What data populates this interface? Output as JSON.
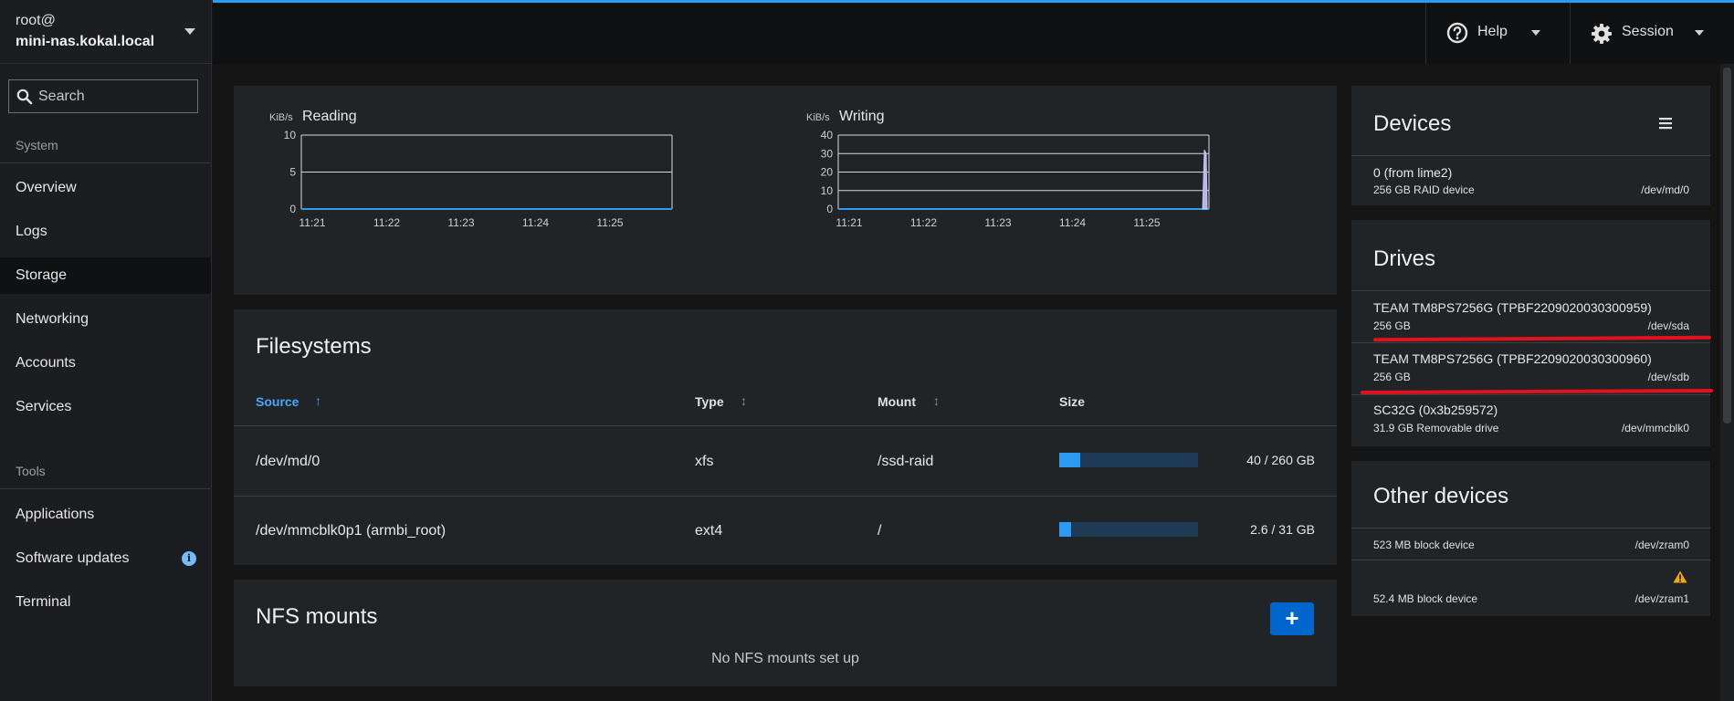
{
  "host": {
    "user": "root@",
    "name": "mini-nas.kokal.local"
  },
  "search": {
    "placeholder": "Search"
  },
  "nav": {
    "system_label": "System",
    "tools_label": "Tools",
    "items": [
      {
        "label": "Overview"
      },
      {
        "label": "Logs"
      },
      {
        "label": "Storage"
      },
      {
        "label": "Networking"
      },
      {
        "label": "Accounts"
      },
      {
        "label": "Services"
      },
      {
        "label": "Applications"
      },
      {
        "label": "Software updates"
      },
      {
        "label": "Terminal"
      }
    ],
    "active": "Storage",
    "updates_badge": "i"
  },
  "topbar": {
    "help_label": "Help",
    "session_label": "Session"
  },
  "reading_chart": {
    "unit": "KiB/s",
    "title": "Reading",
    "ticks_y": [
      "10",
      "5",
      "0"
    ],
    "ticks_x": [
      "11:21",
      "11:22",
      "11:23",
      "11:24",
      "11:25"
    ]
  },
  "writing_chart": {
    "unit": "KiB/s",
    "title": "Writing",
    "ticks_y": [
      "40",
      "30",
      "20",
      "10",
      "0"
    ],
    "ticks_x": [
      "11:21",
      "11:22",
      "11:23",
      "11:24",
      "11:25"
    ]
  },
  "chart_data": [
    {
      "type": "area",
      "title": "Reading",
      "ylabel": "KiB/s",
      "ylim": [
        0,
        10
      ],
      "x": [
        "11:21",
        "11:22",
        "11:23",
        "11:24",
        "11:25"
      ],
      "series": [
        {
          "values": [
            0,
            0,
            0,
            0,
            0
          ]
        }
      ]
    },
    {
      "type": "area",
      "title": "Writing",
      "ylabel": "KiB/s",
      "ylim": [
        0,
        40
      ],
      "x": [
        "11:21",
        "11:22",
        "11:23",
        "11:24",
        "11:25"
      ],
      "series": [
        {
          "values": [
            0,
            0,
            0,
            0,
            0
          ],
          "spike_at_end": 32
        }
      ]
    }
  ],
  "filesystems": {
    "title": "Filesystems",
    "columns": {
      "source": "Source",
      "type": "Type",
      "mount": "Mount",
      "size": "Size"
    },
    "rows": [
      {
        "source": "/dev/md/0",
        "type": "xfs",
        "mount": "/ssd-raid",
        "size": "40 / 260 GB",
        "used_fraction": 0.154
      },
      {
        "source": "/dev/mmcblk0p1 (armbi_root)",
        "type": "ext4",
        "mount": "/",
        "size": "2.6 / 31 GB",
        "used_fraction": 0.084
      }
    ]
  },
  "nfs": {
    "title": "NFS mounts",
    "add_label": "+",
    "empty": "No NFS mounts set up"
  },
  "devices": {
    "title": "Devices",
    "items": [
      {
        "name": "0 (from lime2)",
        "desc": "256 GB RAID device",
        "path": "/dev/md/0"
      }
    ]
  },
  "drives": {
    "title": "Drives",
    "items": [
      {
        "name": "TEAM TM8PS7256G (TPBF2209020030300959)",
        "desc": "256 GB",
        "path": "/dev/sda"
      },
      {
        "name": "TEAM TM8PS7256G (TPBF2209020030300960)",
        "desc": "256 GB",
        "path": "/dev/sdb"
      },
      {
        "name": "SC32G (0x3b259572)",
        "desc": "31.9 GB Removable drive",
        "path": "/dev/mmcblk0"
      }
    ]
  },
  "other_devices": {
    "title": "Other devices",
    "items": [
      {
        "desc": "523 MB block device",
        "path": "/dev/zram0"
      },
      {
        "desc": "52.4 MB block device",
        "path": "/dev/zram1",
        "warning": true
      }
    ]
  },
  "colors": {
    "accent": "#2b9af3",
    "annotation_red": "#e0121d",
    "warning": "#f0ab00"
  }
}
